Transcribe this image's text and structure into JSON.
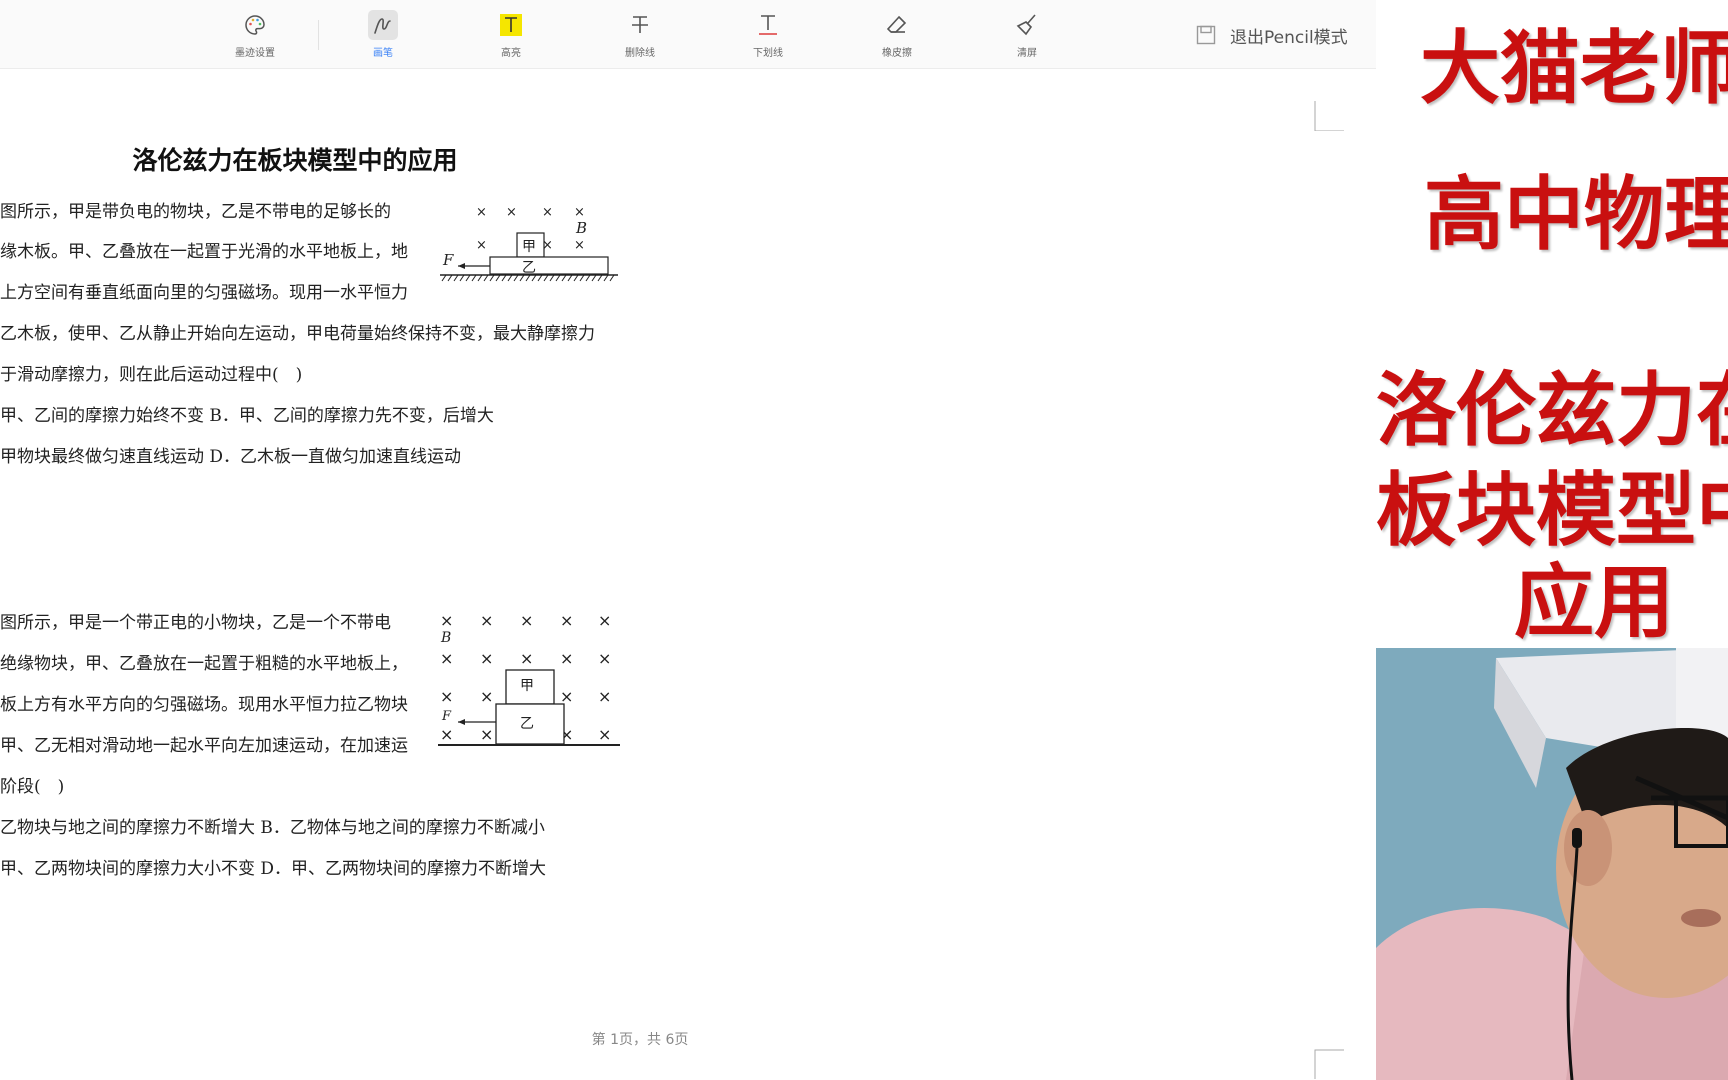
{
  "toolbar": {
    "tools": [
      {
        "label": "墨迹设置",
        "icon": "palette-icon"
      },
      {
        "label": "画笔",
        "icon": "pen-icon"
      },
      {
        "label": "高亮",
        "icon": "highlight-icon"
      },
      {
        "label": "删除线",
        "icon": "strikethrough-icon"
      },
      {
        "label": "下划线",
        "icon": "underline-icon"
      },
      {
        "label": "橡皮擦",
        "icon": "eraser-icon"
      },
      {
        "label": "清屏",
        "icon": "broom-icon"
      }
    ],
    "active_tool": "画笔",
    "exit_label": "退出Pencil模式",
    "highlight_color": "#f5e600",
    "active_color": "#3b82f6"
  },
  "document": {
    "title": "洛伦兹力在板块模型中的应用",
    "problem1": {
      "lines": [
        "图所示，甲是带负电的物块，乙是不带电的足够长的",
        "缘木板。甲、乙叠放在一起置于光滑的水平地板上，地",
        "上方空间有垂直纸面向里的匀强磁场。现用一水平恒力",
        "乙木板，使甲、乙从静止开始向左运动，甲电荷量始终保持不变，最大静摩擦力",
        "于滑动摩擦力，则在此后运动过程中(　)",
        "甲、乙间的摩擦力始终不变 B．甲、乙间的摩擦力先不变，后增大",
        "甲物块最终做匀速直线运动 D．乙木板一直做匀加速直线运动"
      ],
      "figure": {
        "force": "F",
        "field": "B",
        "top_block": "甲",
        "bottom_block": "乙"
      }
    },
    "problem2": {
      "lines": [
        "图所示，甲是一个带正电的小物块，乙是一个不带电",
        "绝缘物块，甲、乙叠放在一起置于粗糙的水平地板上，",
        "板上方有水平方向的匀强磁场。现用水平恒力拉乙物块",
        "甲、乙无相对滑动地一起水平向左加速运动，在加速运",
        "阶段(　)",
        "乙物块与地之间的摩擦力不断增大 B．乙物体与地之间的摩擦力不断减小",
        "甲、乙两物块间的摩擦力大小不变 D．甲、乙两物块间的摩擦力不断增大"
      ],
      "figure": {
        "force": "F",
        "field": "B",
        "top_block": "甲",
        "bottom_block": "乙"
      }
    },
    "page_number": "第 1页，共 6页"
  },
  "overlay": {
    "line1": "大猫老师",
    "line2": "高中物理",
    "line3": "洛伦兹力在",
    "line4": "板块模型中的",
    "line5": "应用",
    "color": "#c91010"
  }
}
